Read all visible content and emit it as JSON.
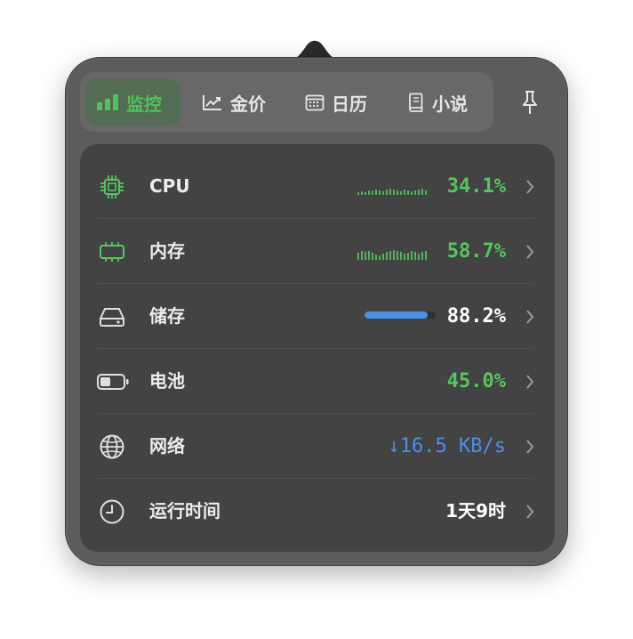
{
  "tabs": [
    {
      "label": "监控",
      "icon": "bar-chart-icon",
      "active": true
    },
    {
      "label": "金价",
      "icon": "trend-line-icon",
      "active": false
    },
    {
      "label": "日历",
      "icon": "calendar-icon",
      "active": false
    },
    {
      "label": "小说",
      "icon": "book-icon",
      "active": false
    }
  ],
  "pin_icon": "pin-icon",
  "rows": {
    "cpu": {
      "label": "CPU",
      "value": "34.1%",
      "icon": "chip-icon",
      "spark": [
        3,
        4,
        3,
        5,
        5,
        6,
        5,
        4,
        6,
        7,
        6,
        5,
        4,
        6,
        5,
        4,
        5,
        6,
        7,
        5
      ],
      "color": "#56c560"
    },
    "memory": {
      "label": "内存",
      "value": "58.7%",
      "icon": "memory-icon",
      "spark": [
        8,
        10,
        9,
        10,
        8,
        6,
        5,
        7,
        9,
        10,
        11,
        10,
        9,
        7,
        8,
        10,
        9,
        7,
        9,
        10
      ],
      "color": "#56c560"
    },
    "storage": {
      "label": "储存",
      "value": "88.2%",
      "icon": "drive-icon",
      "level": 0.882,
      "color": "#4a8fe8"
    },
    "battery": {
      "label": "电池",
      "value": "45.0%",
      "icon": "battery-icon",
      "color": "#56c560"
    },
    "network": {
      "label": "网络",
      "value": "↓16.5 KB/s",
      "icon": "globe-icon",
      "color": "#4a8fe8"
    },
    "uptime": {
      "label": "运行时间",
      "value": "1天9时",
      "icon": "clock-icon"
    }
  }
}
